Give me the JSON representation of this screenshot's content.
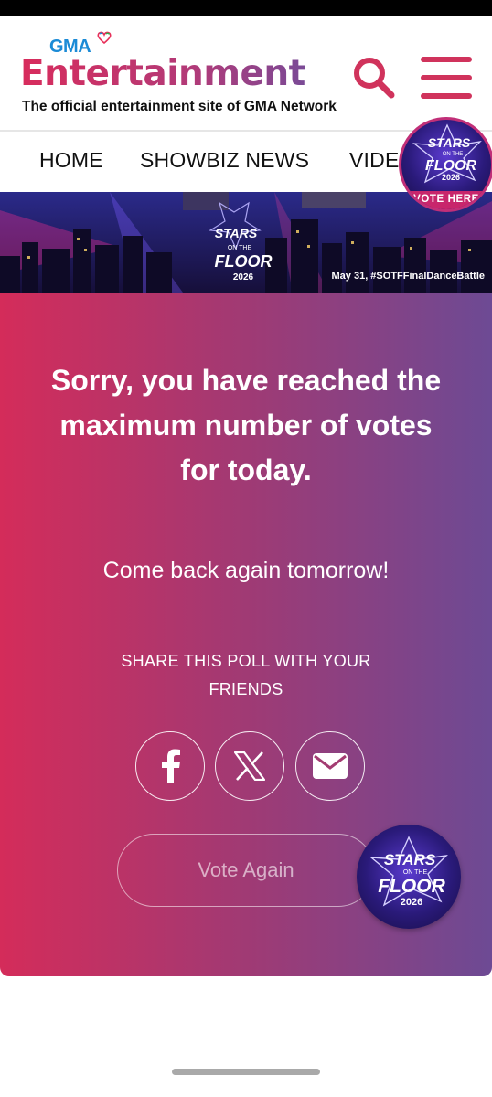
{
  "header": {
    "network_logo": "GMA",
    "title": "Entertainment",
    "tagline": "The official entertainment site of GMA Network",
    "search_icon": "search-icon",
    "menu_icon": "hamburger-menu-icon",
    "accent_color": "#d0335c"
  },
  "nav": {
    "items": [
      {
        "label": "HOME"
      },
      {
        "label": "SHOWBIZ NEWS"
      },
      {
        "label": "VIDE"
      }
    ]
  },
  "banner": {
    "show_logo_line1": "STARS",
    "show_logo_line2": "ON THE",
    "show_logo_line3": "FLOOR",
    "show_logo_year": "2026",
    "caption": "May 31, #SOTFFinalDanceBattle"
  },
  "vote_badge": {
    "logo_line1": "STARS",
    "logo_line2": "ON THE",
    "logo_line3": "FLOOR",
    "year": "2026",
    "label": "VOTE HERE"
  },
  "card": {
    "message": "Sorry, you have reached the maximum number of votes for today.",
    "sub_message": "Come back again tomorrow!",
    "share_text": "SHARE THIS POLL WITH YOUR FRIENDS",
    "share_buttons": [
      {
        "icon": "facebook-icon"
      },
      {
        "icon": "x-twitter-icon"
      },
      {
        "icon": "mail-icon"
      }
    ],
    "vote_again_label": "Vote Again",
    "gradient_start": "#d42c5a",
    "gradient_end": "#6d4a94"
  },
  "floating_badge": {
    "logo_line1": "STARS",
    "logo_line2": "ON THE",
    "logo_line3": "FLOOR",
    "year": "2026"
  }
}
